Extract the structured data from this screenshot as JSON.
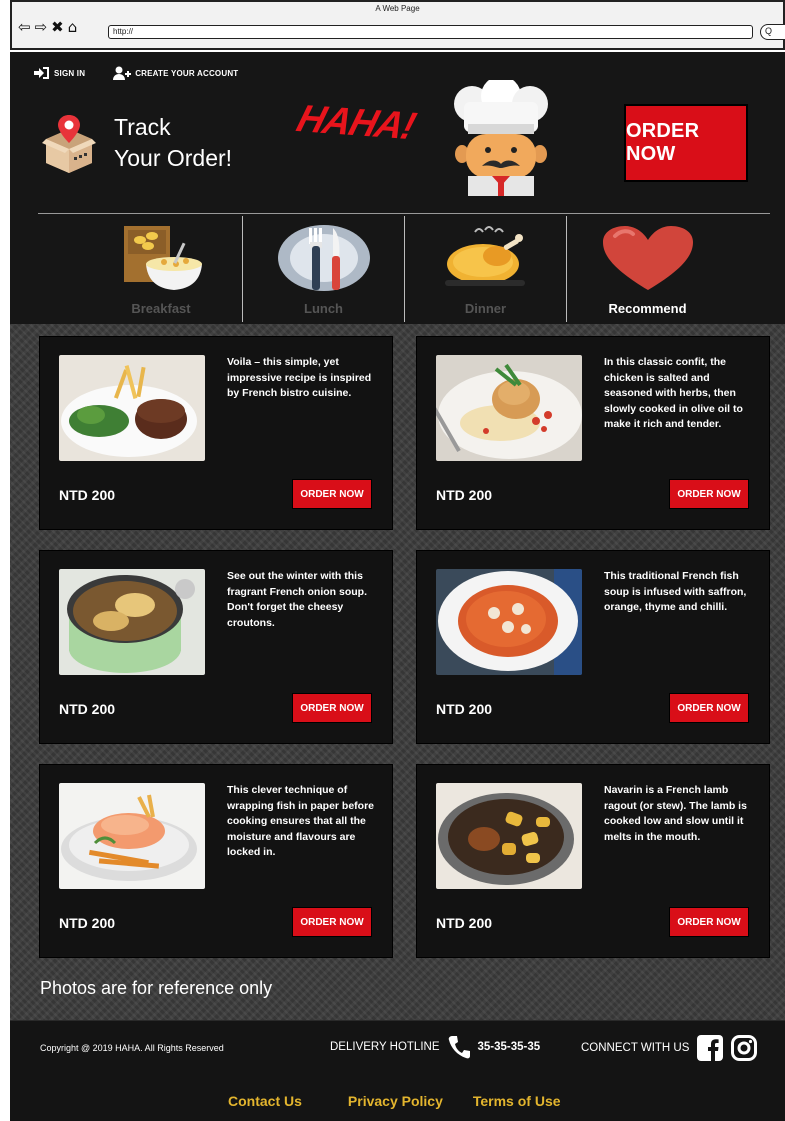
{
  "browser": {
    "window_title": "A Web Page",
    "url": "http://",
    "search_glyph": "Q"
  },
  "topbar": {
    "sign_in": "SIGN IN",
    "create_account": "CREATE YOUR ACCOUNT"
  },
  "hero": {
    "track_text": "Track\nYour Order!",
    "logo": "HAHA!",
    "order_button": "ORDER NOW"
  },
  "categories": [
    {
      "label": "Breakfast",
      "icon": "cereal-box-icon",
      "active": false
    },
    {
      "label": "Lunch",
      "icon": "plate-cutlery-icon",
      "active": false
    },
    {
      "label": "Dinner",
      "icon": "roast-chicken-icon",
      "active": false
    },
    {
      "label": "Recommend",
      "icon": "heart-icon",
      "active": true
    }
  ],
  "dishes": [
    {
      "desc": "Voila – this simple, yet impressive recipe is inspired by French bistro cuisine.",
      "price": "NTD 200",
      "button": "ORDER NOW"
    },
    {
      "desc": "In this classic confit, the chicken is salted and seasoned with herbs, then slowly cooked in olive oil to make it rich and tender.",
      "price": "NTD 200",
      "button": "ORDER NOW"
    },
    {
      "desc": "See out the winter with this fragrant French onion soup. Don't forget the cheesy croutons.",
      "price": "NTD 200",
      "button": "ORDER NOW"
    },
    {
      "desc": "This traditional French fish soup is infused with saffron, orange, thyme and chilli.",
      "price": "NTD 200",
      "button": "ORDER NOW"
    },
    {
      "desc": "This clever technique of wrapping fish in paper before cooking ensures that all the moisture and flavours are locked in.",
      "price": "NTD 200",
      "button": "ORDER NOW"
    },
    {
      "desc": "Navarin is a French lamb ragout (or stew). The lamb is cooked low and slow until it melts in the mouth.",
      "price": "NTD 200",
      "button": "ORDER NOW"
    }
  ],
  "note": "Photos are for reference only",
  "footer": {
    "copyright": "Copyright @ 2019 HAHA. All Rights Reserved",
    "hotline_label": "DELIVERY HOTLINE",
    "hotline_number": "35-35-35-35",
    "connect_label": "CONNECT WITH US",
    "links": [
      "Contact Us",
      "Privacy Policy",
      "Terms of Use"
    ]
  },
  "colors": {
    "accent_red": "#d90e18",
    "link_gold": "#e3b52e",
    "background": "#141414"
  }
}
